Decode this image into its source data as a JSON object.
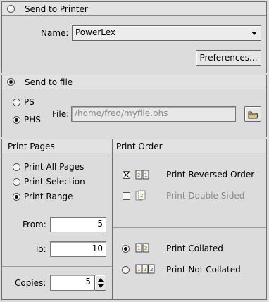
{
  "printer": {
    "title": "Send to Printer",
    "name_label": "Name:",
    "name_value": "PowerLex",
    "preferences_label": "Preferences..."
  },
  "file": {
    "title": "Send to file",
    "ps_label": "PS",
    "phs_label": "PHS",
    "file_label": "File:",
    "file_value": "/home/fred/myfile.phs",
    "folder_icon": "folder-icon"
  },
  "pages": {
    "title": "Print Pages",
    "all_label": "Print All Pages",
    "selection_label": "Print Selection",
    "range_label": "Print Range",
    "from_label": "From:",
    "from_value": "5",
    "to_label": "To:",
    "to_value": "10",
    "copies_label": "Copies:",
    "copies_value": "5"
  },
  "order": {
    "title": "Print Order",
    "reversed_label": "Print Reversed Order",
    "double_label": "Print Double Sided",
    "collated_label": "Print Collated",
    "not_collated_label": "Print Not Collated"
  }
}
